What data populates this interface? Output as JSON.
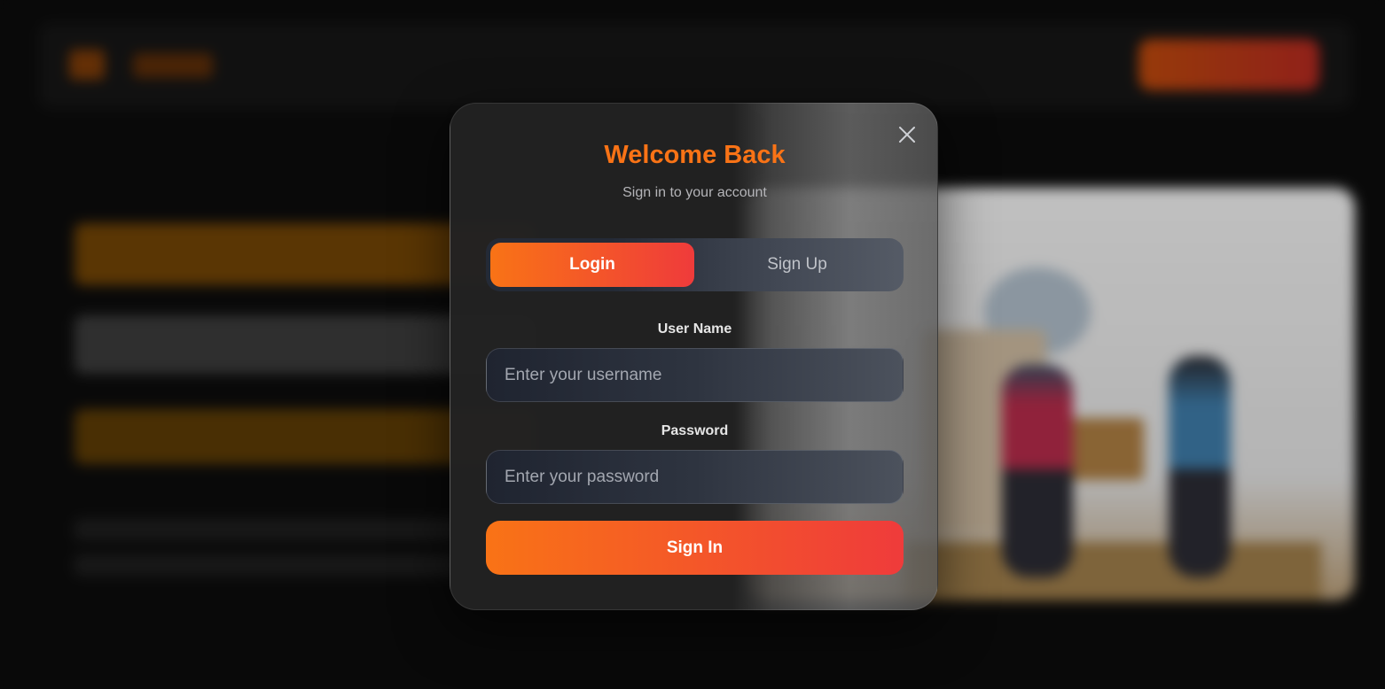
{
  "modal": {
    "title": "Welcome Back",
    "subtitle": "Sign in to your account",
    "close_icon": "close-icon",
    "tabs": [
      {
        "label": "Login",
        "active": true
      },
      {
        "label": "Sign Up",
        "active": false
      }
    ],
    "username": {
      "label": "User Name",
      "placeholder": "Enter your username",
      "value": ""
    },
    "password": {
      "label": "Password",
      "placeholder": "Enter your password",
      "value": ""
    },
    "submit_label": "Sign In"
  },
  "colors": {
    "accent": "#f97316",
    "accent_end": "#ef3b3b",
    "page_background": "#0b0b0b",
    "modal_background": "#222222"
  }
}
